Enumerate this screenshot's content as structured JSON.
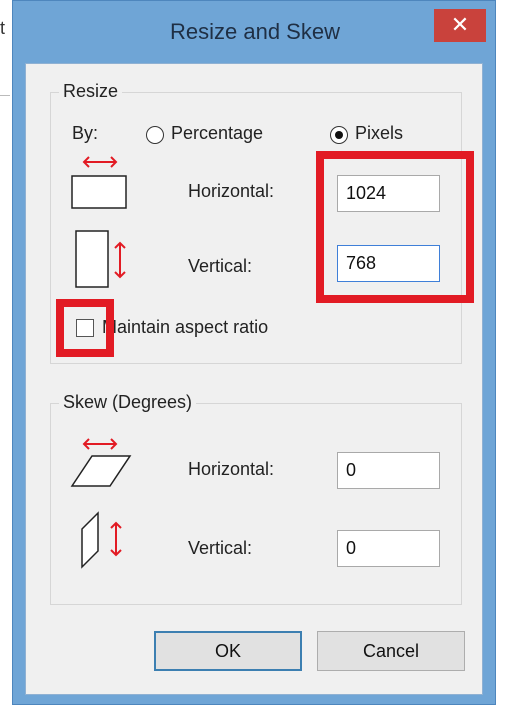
{
  "background": {
    "glyph": "t"
  },
  "window": {
    "title": "Resize and Skew",
    "close_label": "✕"
  },
  "resize": {
    "group_title": "Resize",
    "by_label": "By:",
    "options": [
      {
        "label": "Percentage",
        "selected": false
      },
      {
        "label": "Pixels",
        "selected": true
      }
    ],
    "horizontal_label": "Horizontal:",
    "horizontal_value": "1024",
    "vertical_label": "Vertical:",
    "vertical_value": "768",
    "maintain_label": "Maintain aspect ratio",
    "maintain_checked": false
  },
  "skew": {
    "group_title": "Skew (Degrees)",
    "horizontal_label": "Horizontal:",
    "horizontal_value": "0",
    "vertical_label": "Vertical:",
    "vertical_value": "0"
  },
  "buttons": {
    "ok_label": "OK",
    "cancel_label": "Cancel"
  },
  "colors": {
    "title_bar": "#6fa5d6",
    "close_button": "#c9423c",
    "highlight": "#e21b24",
    "arrow": "#e21b24"
  }
}
